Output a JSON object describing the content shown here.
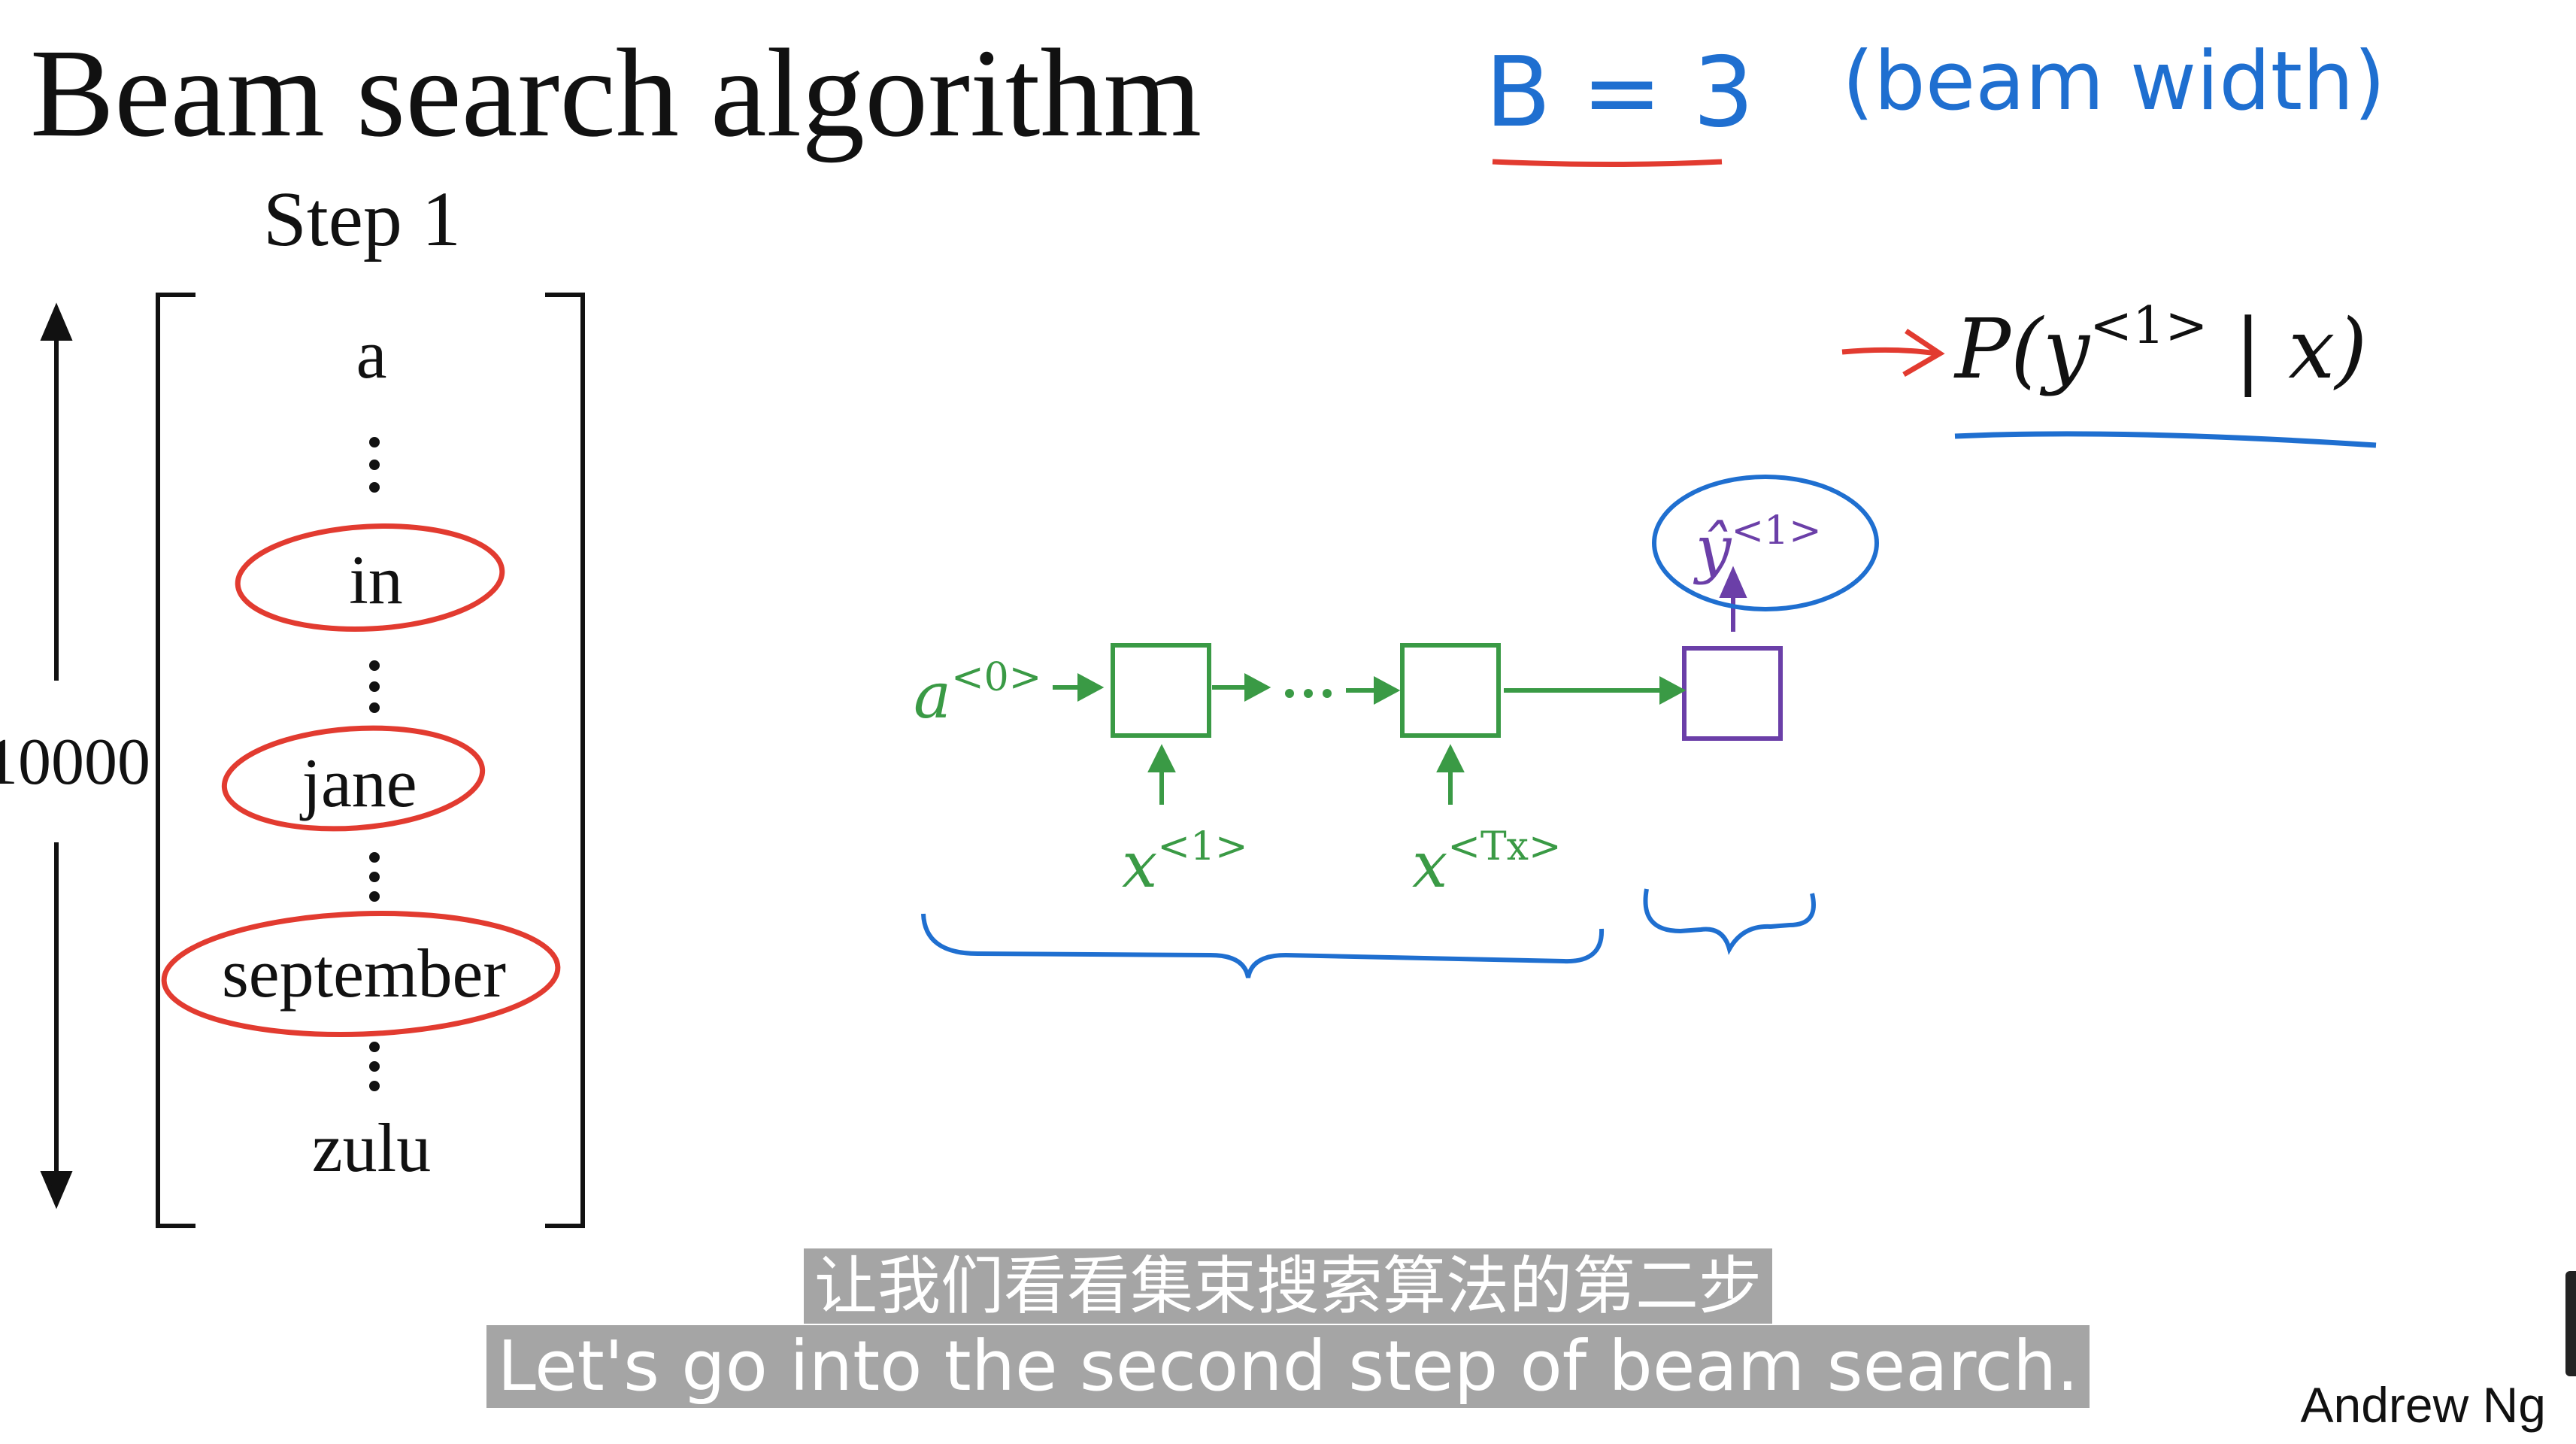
{
  "slide": {
    "title": "Beam search algorithm",
    "step_label": "Step 1",
    "beam_note": "B = 3",
    "beam_note_paren": "(beam width)",
    "vocabulary": [
      "a",
      "in",
      "jane",
      "september",
      "zulu"
    ],
    "vocabulary_size_label": "10000",
    "circled_words": [
      "in",
      "jane",
      "september"
    ],
    "probability": {
      "prefix": "P(y",
      "superscript": "<1>",
      "suffix": " | x)"
    },
    "rnn": {
      "initial_state": "a",
      "initial_state_sup": "<0>",
      "input_first": "x",
      "input_first_sup": "<1>",
      "input_last": "x",
      "input_last_sup": "<Tx>",
      "output": "ŷ",
      "output_sup": "<1>",
      "ellipsis": "· · ·"
    },
    "colors": {
      "ink": "#111111",
      "handwriting_blue": "#1f6fd0",
      "handwriting_red": "#e23b30",
      "network_green": "#3a9a45",
      "decoder_purple": "#6b3fa8"
    }
  },
  "subtitles": {
    "zh": "让我们看看集束搜索算法的第二步",
    "en": "Let's go into the second step of beam search."
  },
  "credit": "Andrew Ng"
}
